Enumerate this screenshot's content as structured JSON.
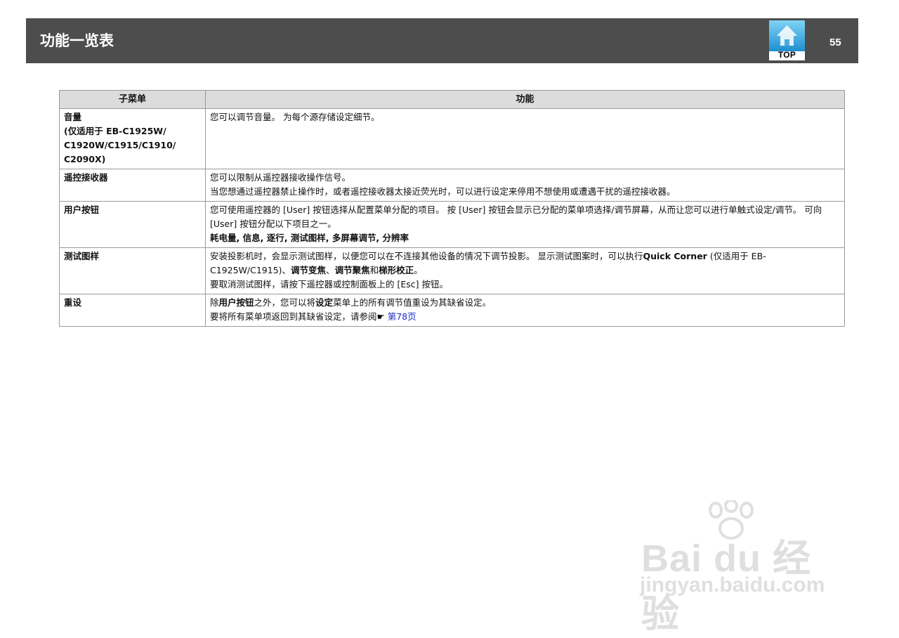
{
  "header": {
    "title": "功能一览表",
    "top_button_label": "TOP",
    "page_number": "55"
  },
  "table": {
    "headers": [
      "子菜单",
      "功能"
    ],
    "rows": [
      {
        "submenu": [
          "音量",
          "(仅适用于 EB-C1925W/",
          "C1920W/C1915/C1910/",
          "C2090X)"
        ],
        "function": {
          "line1": "您可以调节音量。 为每个源存储设定细节。"
        }
      },
      {
        "submenu": [
          "遥控接收器"
        ],
        "function": {
          "line1": "您可以限制从遥控器接收操作信号。",
          "line2": "当您想通过遥控器禁止操作时，或者遥控接收器太接近荧光时，可以进行设定来停用不想使用或遭遇干扰的遥控接收器。"
        }
      },
      {
        "submenu": [
          "用户按钮"
        ],
        "function": {
          "line1": "您可使用遥控器的 [User] 按钮选择从配置菜单分配的项目。 按 [User] 按钮会显示已分配的菜单项选择/调节屏幕，从而让您可以进行单触式设定/调节。 可向 [User] 按钮分配以下项目之一。",
          "line2": "耗电量, 信息, 逐行, 测试图样, 多屏幕调节, 分辨率"
        }
      },
      {
        "submenu": [
          "测试图样"
        ],
        "function": {
          "p1_a": "安装投影机时，会显示测试图样，以便您可以在不连接其他设备的情况下调节投影。 显示测试图案时，可以执行",
          "p1_b": "Quick Corner",
          "p1_c": " (仅适用于 EB-C1925W/C1915)、",
          "p1_d": "调节变焦",
          "p1_e": "、",
          "p1_f": "调节聚焦",
          "p1_g": "和",
          "p1_h": "梯形校正",
          "p1_i": "。",
          "line2": "要取消测试图样，请按下遥控器或控制面板上的 [Esc] 按钮。"
        }
      },
      {
        "submenu": [
          "重设"
        ],
        "function": {
          "p1_a": "除",
          "p1_b": "用户按钮",
          "p1_c": "之外，您可以将",
          "p1_d": "设定",
          "p1_e": "菜单上的所有调节值重设为其缺省设定。",
          "p2_a": "要将所有菜单项返回到其缺省设定，请参阅",
          "p2_hand": "☛",
          "p2_link": " 第78页"
        }
      }
    ]
  },
  "watermark": {
    "brand": "Bai du 经验",
    "site": "jingyan.baidu.com"
  },
  "colors": {
    "header_bg": "#4d4d4d",
    "table_header_bg": "#dcdcdc",
    "link": "#1a2cc4"
  }
}
